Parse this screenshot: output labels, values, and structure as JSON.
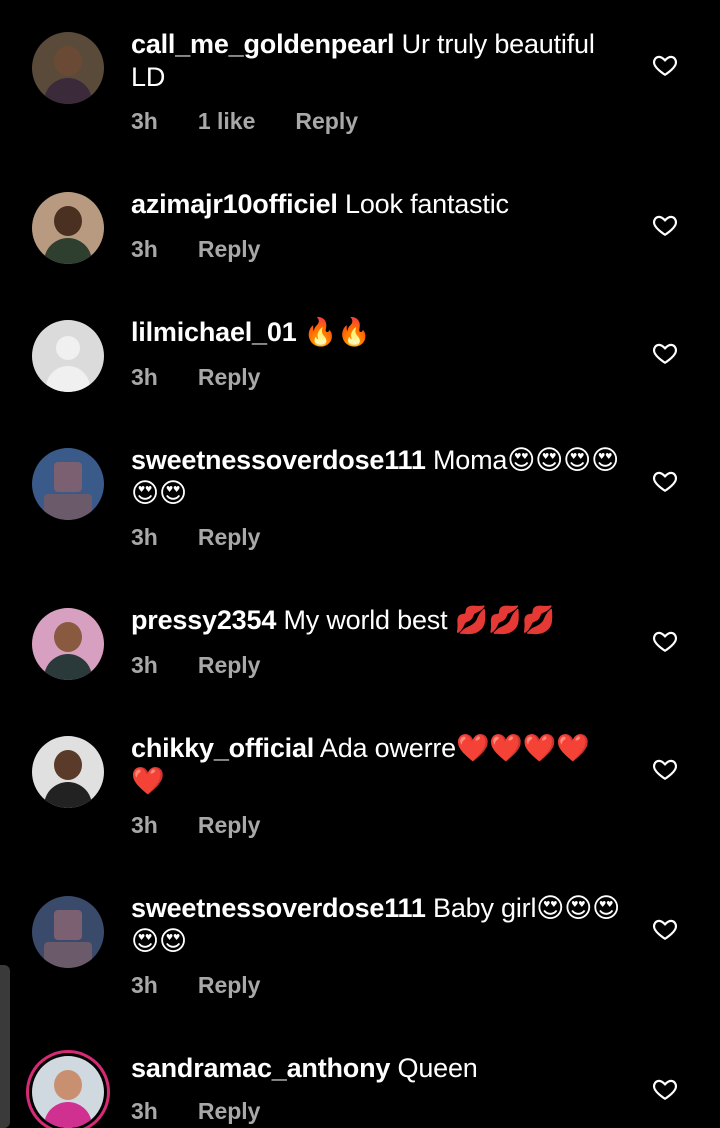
{
  "comments": [
    {
      "username": "call_me_goldenpearl",
      "text": "Ur truly beautiful LD",
      "time": "3h",
      "likes": "1 like",
      "reply": "Reply"
    },
    {
      "username": "azimajr10officiel",
      "text": "Look fantastic",
      "time": "3h",
      "reply": "Reply"
    },
    {
      "username": "lilmichael_01",
      "text": "🔥🔥",
      "time": "3h",
      "reply": "Reply"
    },
    {
      "username": "sweetnessoverdose111",
      "text": "Moma😍😍😍😍😍😍",
      "time": "3h",
      "reply": "Reply"
    },
    {
      "username": "pressy2354",
      "text": "My world best 💋💋💋",
      "time": "3h",
      "reply": "Reply"
    },
    {
      "username": "chikky_official",
      "text": "Ada owerre❤️❤️❤️❤️❤️",
      "time": "3h",
      "reply": "Reply"
    },
    {
      "username": "sweetnessoverdose111",
      "text": "Baby girl😍😍😍😍😍",
      "time": "3h",
      "reply": "Reply"
    },
    {
      "username": "sandramac_anthony",
      "text": "Queen",
      "time": "3h",
      "reply": "Reply"
    }
  ],
  "icons": {
    "like": "heart-outline-icon"
  },
  "colors": {
    "background": "#000000",
    "meta_text": "#a8a8a8",
    "story_ring": "#d62976"
  }
}
